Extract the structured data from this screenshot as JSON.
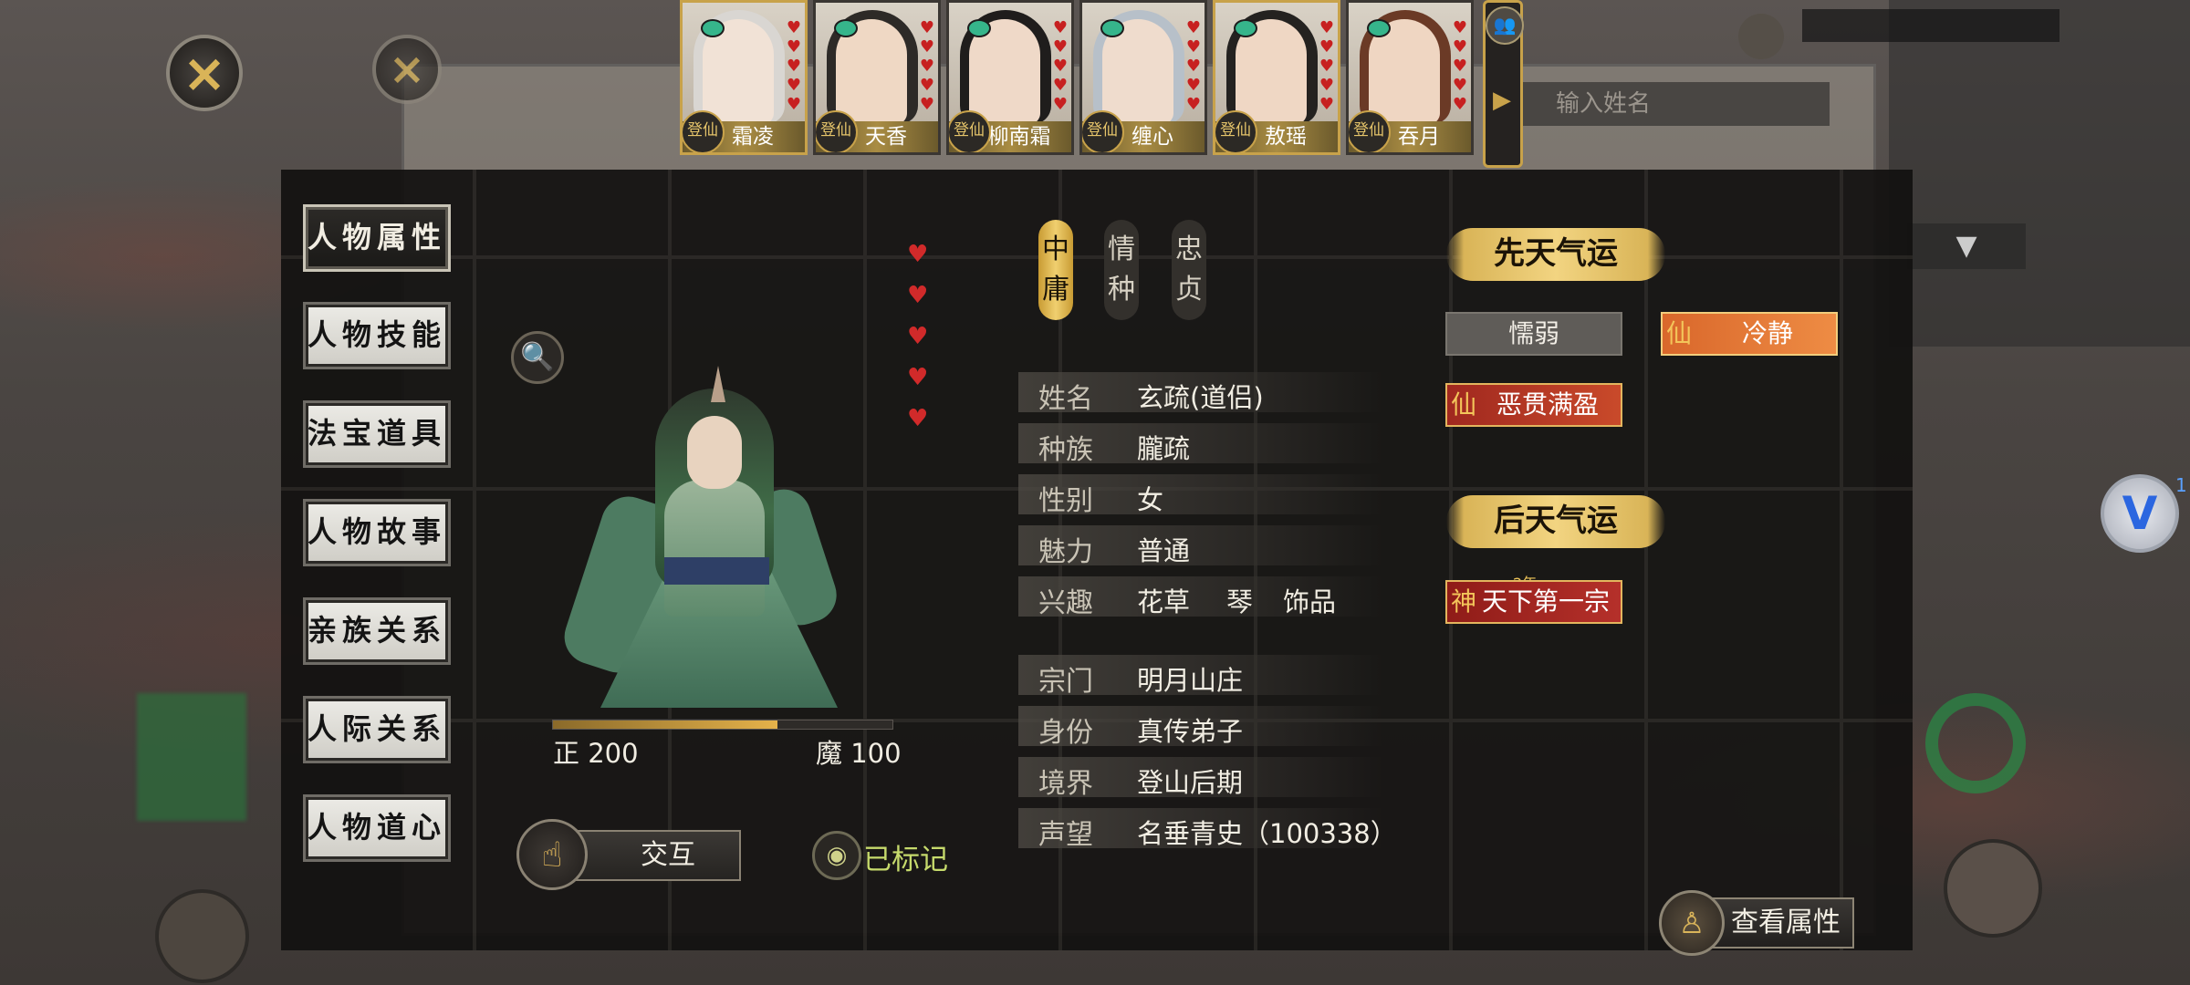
{
  "close_icon": "×",
  "background": {
    "input_placeholder": "输入姓名",
    "dropdown_glyph": "▼"
  },
  "top_strip": {
    "badge": "登仙",
    "characters": [
      {
        "name": "霜凌",
        "hair": "#d9d6d2",
        "face": "#f1e2d6",
        "hearts": 5
      },
      {
        "name": "天香",
        "hair": "#2d2a27",
        "face": "#efd8c4",
        "hearts": 5
      },
      {
        "name": "柳南霜",
        "hair": "#1f1d1c",
        "face": "#efd9c8",
        "hearts": 5
      },
      {
        "name": "缠心",
        "hair": "#b7c0c9",
        "face": "#efdccd",
        "hearts": 5
      },
      {
        "name": "敖瑶",
        "hair": "#242220",
        "face": "#efd7c4",
        "hearts": 5
      },
      {
        "name": "吞月",
        "hair": "#6b3a26",
        "face": "#efd6c2",
        "hearts": 5
      }
    ],
    "heart_glyph": "♥",
    "arrow_glyph": "▶",
    "people_glyph": "👥"
  },
  "tabs": [
    {
      "label": "人物属性",
      "active": true
    },
    {
      "label": "人物技能",
      "active": false
    },
    {
      "label": "法宝道具",
      "active": false
    },
    {
      "label": "人物故事",
      "active": false
    },
    {
      "label": "亲族关系",
      "active": false
    },
    {
      "label": "人际关系",
      "active": false
    },
    {
      "label": "人物道心",
      "active": false
    }
  ],
  "portrait": {
    "search_glyph": "🔍",
    "hearts": 5,
    "morality": {
      "zheng_label": "正 200",
      "mo_label": "魔 100",
      "zheng": 200,
      "mo": 100,
      "fill_fraction": 0.66
    }
  },
  "actions": {
    "interact_label": "交互",
    "interact_glyph": "☝",
    "marked_label": "已标记",
    "eye_glyph": "◉",
    "view_attr_label": "查看属性",
    "view_attr_glyph": "♙"
  },
  "personality_tags": [
    {
      "text": "中庸",
      "style": "gold"
    },
    {
      "text": "情种",
      "style": "dark"
    },
    {
      "text": "忠贞",
      "style": "dark"
    }
  ],
  "attributes": [
    {
      "key": "姓名",
      "value": "玄疏(道侣)"
    },
    {
      "key": "种族",
      "value": "朧疏"
    },
    {
      "key": "性别",
      "value": "女"
    },
    {
      "key": "魅力",
      "value": "普通"
    },
    {
      "key": "兴趣",
      "hobbies": [
        "花草",
        "琴",
        "饰品"
      ]
    },
    {
      "key": "宗门",
      "value": "明月山庄"
    },
    {
      "key": "身份",
      "value": "真传弟子"
    },
    {
      "key": "境界",
      "value": "登山后期"
    },
    {
      "key": "声望",
      "value": "名垂青史（100338）"
    }
  ],
  "fortune": {
    "innate_title": "先天气运",
    "acquired_title": "后天气运",
    "innate_traits": [
      {
        "label": "懦弱",
        "style": "gray"
      },
      {
        "label": "冷静",
        "style": "orange",
        "symbol": "仙"
      },
      {
        "label": "恶贯满盈",
        "style": "red",
        "symbol": "仙"
      }
    ],
    "acquired_traits": [
      {
        "label": "天下第一宗",
        "symbol": "神",
        "year_tag": "2年"
      }
    ]
  },
  "floating": {
    "label": "V",
    "count": "1"
  }
}
